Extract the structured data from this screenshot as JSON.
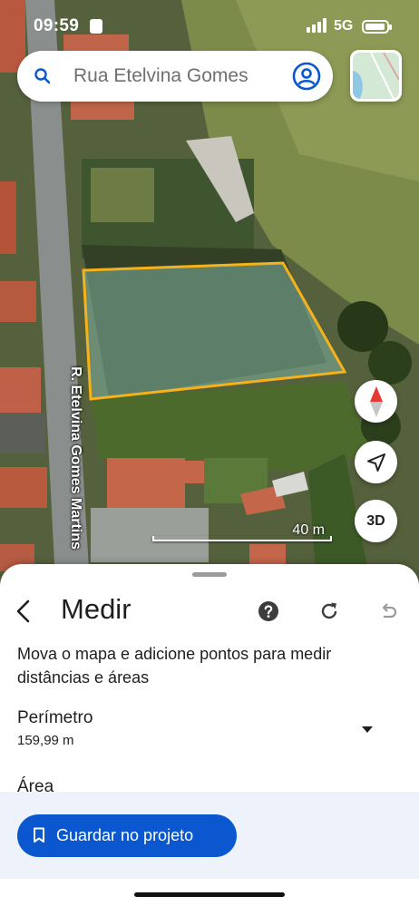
{
  "status_bar": {
    "time": "09:59",
    "network": "5G"
  },
  "search": {
    "placeholder": "Rua Etelvina Gomes"
  },
  "map": {
    "street_label": "R. Etelvina Gomes Martins",
    "scale_label": "40 m",
    "button_3d": "3D",
    "polygon_color": "#f5b21b"
  },
  "measure": {
    "title": "Medir",
    "description": "Mova o mapa e adicione pontos para medir distâncias e áreas",
    "perimeter_label": "Perímetro",
    "perimeter_value": "159,99 m",
    "area_label": "Área",
    "save_button": "Guardar no projeto"
  },
  "icons": {
    "search": "search-icon",
    "account": "account-icon",
    "compass": "compass-icon",
    "locate": "navigation-arrow-icon",
    "back": "chevron-left-icon",
    "help": "help-circle-icon",
    "redo": "refresh-icon",
    "undo": "undo-icon",
    "dropdown": "caret-down-icon",
    "bookmark": "bookmark-icon"
  },
  "colors": {
    "accent": "#0b57d0",
    "compass_red": "#e53935"
  }
}
